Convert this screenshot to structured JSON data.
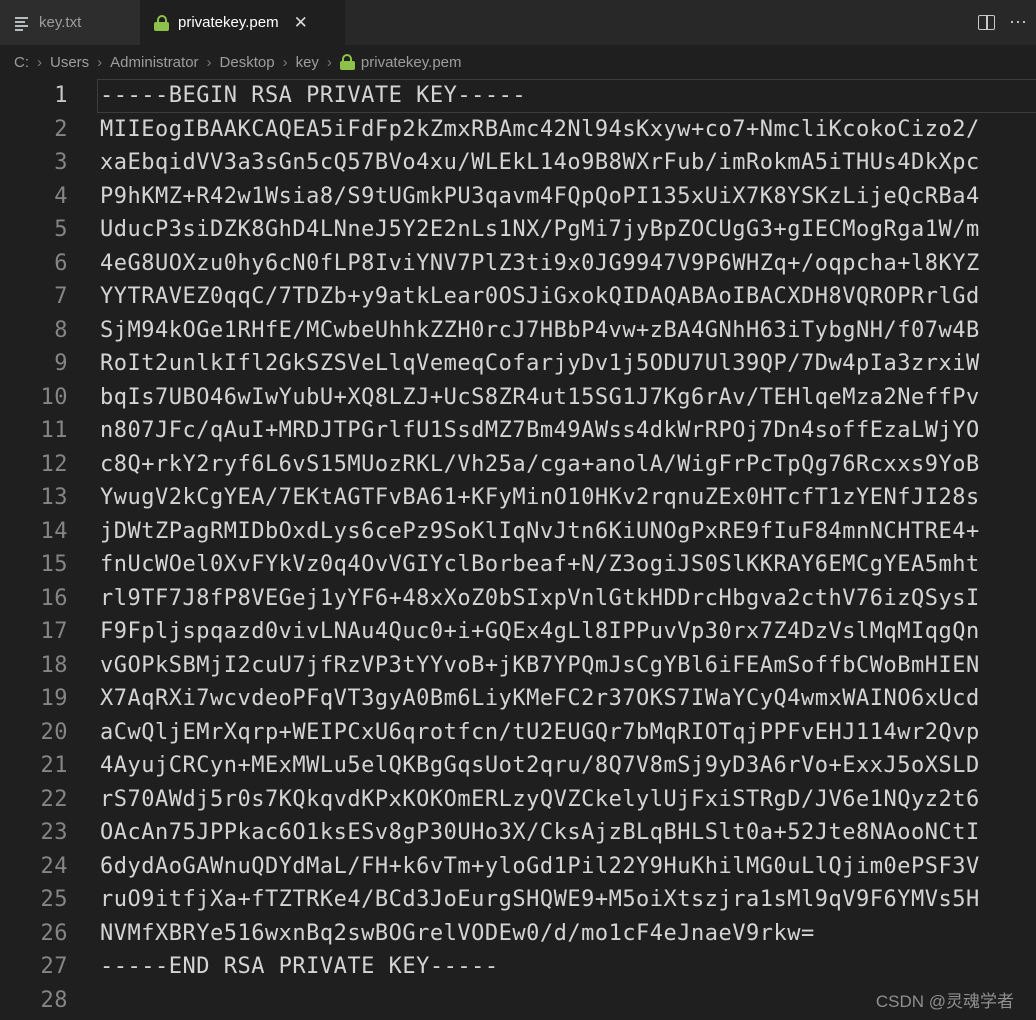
{
  "tabs": [
    {
      "label": "key.txt",
      "icon": "text-file-icon",
      "active": false
    },
    {
      "label": "privatekey.pem",
      "icon": "lock-icon",
      "active": true,
      "close_label": "✕"
    }
  ],
  "editor_actions": {
    "split_editor": "split-editor-icon",
    "more_actions": "⋯"
  },
  "breadcrumb": {
    "items": [
      "C:",
      "Users",
      "Administrator",
      "Desktop",
      "key",
      "privatekey.pem"
    ],
    "separator": "›",
    "last_item_icon": "lock-icon"
  },
  "editor": {
    "active_line": 1,
    "lines": [
      "-----BEGIN RSA PRIVATE KEY-----",
      "MIIEogIBAAKCAQEA5iFdFp2kZmxRBAmc42Nl94sKxyw+co7+NmcliKcokoCizo2/",
      "xaEbqidVV3a3sGn5cQ57BVo4xu/WLEkL14o9B8WXrFub/imRokmA5iTHUs4DkXpc",
      "P9hKMZ+R42w1Wsia8/S9tUGmkPU3qavm4FQpQoPI135xUiX7K8YSKzLijeQcRBa4",
      "UducP3siDZK8GhD4LNneJ5Y2E2nLs1NX/PgMi7jyBpZOCUgG3+gIECMogRga1W/m",
      "4eG8UOXzu0hy6cN0fLP8IviYNV7PlZ3ti9x0JG9947V9P6WHZq+/oqpcha+l8KYZ",
      "YYTRAVEZ0qqC/7TDZb+y9atkLear0OSJiGxokQIDAQABAoIBACXDH8VQROPRrlGd",
      "SjM94kOGe1RHfE/MCwbeUhhkZZH0rcJ7HBbP4vw+zBA4GNhH63iTybgNH/f07w4B",
      "RoIt2unlkIfl2GkSZSVeLlqVemeqCofarjyDv1j5ODU7Ul39QP/7Dw4pIa3zrxiW",
      "bqIs7UBO46wIwYubU+XQ8LZJ+UcS8ZR4ut15SG1J7Kg6rAv/TEHlqeMza2NeffPv",
      "n807JFc/qAuI+MRDJTPGrlfU1SsdMZ7Bm49AWss4dkWrRPOj7Dn4soffEzaLWjYO",
      "c8Q+rkY2ryf6L6vS15MUozRKL/Vh25a/cga+anolA/WigFrPcTpQg76Rcxxs9YoB",
      "YwugV2kCgYEA/7EKtAGTFvBA61+KFyMinO10HKv2rqnuZEx0HTcfT1zYENfJI28s",
      "jDWtZPagRMIDbOxdLys6cePz9SoKlIqNvJtn6KiUNOgPxRE9fIuF84mnNCHTRE4+",
      "fnUcWOel0XvFYkVz0q4OvVGIYclBorbeaf+N/Z3ogiJS0SlKKRAY6EMCgYEA5mht",
      "rl9TF7J8fP8VEGej1yYF6+48xXoZ0bSIxpVnlGtkHDDrcHbgva2cthV76izQSysI",
      "F9Fpljspqazd0vivLNAu4Quc0+i+GQEx4gLl8IPPuvVp30rx7Z4DzVslMqMIqgQn",
      "vGOPkSBMjI2cuU7jfRzVP3tYYvoB+jKB7YPQmJsCgYBl6iFEAmSoffbCWoBmHIEN",
      "X7AqRXi7wcvdeoPFqVT3gyA0Bm6LiyKMeFC2r37OKS7IWaYCyQ4wmxWAINO6xUcd",
      "aCwQljEMrXqrp+WEIPCxU6qrotfcn/tU2EUGQr7bMqRIOTqjPPFvEHJ114wr2Qvp",
      "4AyujCRCyn+MExMWLu5elQKBgGqsUot2qru/8Q7V8mSj9yD3A6rVo+ExxJ5oXSLD",
      "rS70AWdj5r0s7KQkqvdKPxKOKOmERLzyQVZCkelylUjFxiSTRgD/JV6e1NQyz2t6",
      "OAcAn75JPPkac6O1ksESv8gP30UHo3X/CksAjzBLqBHLSlt0a+52Jte8NAooNCtI",
      "6dydAoGAWnuQDYdMaL/FH+k6vTm+yloGd1Pil22Y9HuKhilMG0uLlQjim0ePSF3V",
      "ruO9itfjXa+fTZTRKe4/BCd3JoEurgSHQWE9+M5oiXtszjra1sMl9qV9F6YMVs5H",
      "NVMfXBRYe516wxnBq2swBOGrelVODEw0/d/mo1cF4eJnaeV9rkw=",
      "-----END RSA PRIVATE KEY-----",
      ""
    ]
  },
  "watermark": "CSDN @灵魂学者",
  "colors": {
    "editor_bg": "#1f1f1f",
    "tabbar_bg": "#282828",
    "inactive_tab_bg": "#2d2d2d",
    "lock_green": "#8dc149",
    "code_text": "#d4d4d4",
    "line_number": "#858585",
    "active_line_number": "#c6c6c6"
  }
}
